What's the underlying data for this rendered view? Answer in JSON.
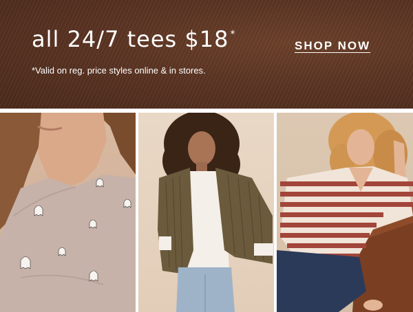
{
  "banner": {
    "headline": "all 24/7 tees $18",
    "headline_mark": "*",
    "disclaimer": "*Valid on reg. price styles online & in stores.",
    "cta_label": "SHOP NOW",
    "background_color": "#5a3322"
  },
  "photos": [
    {
      "label": "ghost-print tee"
    },
    {
      "label": "corduroy jacket outfit"
    },
    {
      "label": "striped v-neck top"
    }
  ]
}
